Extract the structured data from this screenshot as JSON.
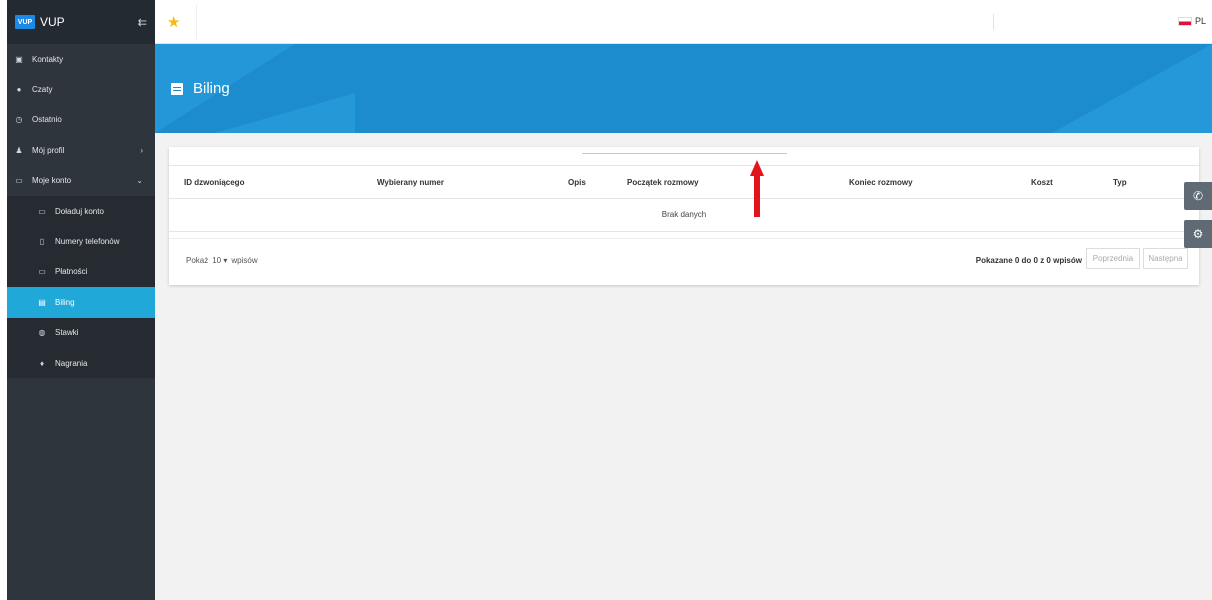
{
  "brand": {
    "logo": "VUP",
    "name": "VUP",
    "toggle_icon": "menu-collapse-icon"
  },
  "sidebar": {
    "items": [
      {
        "label": "Kontakty",
        "icon": "contacts-icon"
      },
      {
        "label": "Czaty",
        "icon": "chat-icon"
      },
      {
        "label": "Ostatnio",
        "icon": "clock-icon"
      },
      {
        "label": "Mój profil",
        "icon": "user-icon",
        "chevron": "›"
      },
      {
        "label": "Moje konto",
        "icon": "money-icon",
        "chevron": "⌄"
      }
    ],
    "subitems": [
      {
        "label": "Doładuj konto",
        "icon": "money-icon"
      },
      {
        "label": "Numery telefonów",
        "icon": "phone-device-icon"
      },
      {
        "label": "Płatności",
        "icon": "payments-icon"
      },
      {
        "label": "Biling",
        "icon": "list-icon",
        "active": true
      },
      {
        "label": "Stawki",
        "icon": "globe-icon"
      },
      {
        "label": "Nagrania",
        "icon": "mic-icon"
      }
    ]
  },
  "topbar": {
    "language": "PL"
  },
  "page": {
    "title": "Biling"
  },
  "table": {
    "columns": [
      "ID dzwoniącego",
      "Wybierany numer",
      "Opis",
      "Początek rozmowy",
      "Koniec rozmowy",
      "Koszt",
      "Typ"
    ],
    "empty_text": "Brak danych"
  },
  "pagination": {
    "show_label": "Pokaż",
    "page_size": "10",
    "entries_label": "wpisów",
    "info": "Pokazane 0 do 0 z 0 wpisów",
    "prev_label": "Poprzednia",
    "next_label": "Następna"
  },
  "colors": {
    "sidebar": "#2f353d",
    "active": "#20a8d8",
    "banner": "#1d8ccf",
    "arrow": "#e3141b"
  }
}
